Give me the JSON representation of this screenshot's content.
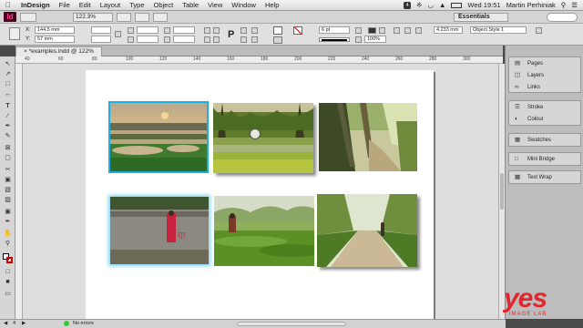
{
  "menubar": {
    "app": "InDesign",
    "items": [
      "File",
      "Edit",
      "Layout",
      "Type",
      "Object",
      "Table",
      "View",
      "Window",
      "Help"
    ],
    "badge": "4",
    "clock": "Wed 19:51",
    "user": "Martin Perhiniak"
  },
  "appbar": {
    "logo": "Id",
    "zoom": "122.3%",
    "workspace": "Essentials"
  },
  "control": {
    "x": "144.5 mm",
    "y": "57 mm",
    "stroke_weight": "6 pt",
    "opacity": "100%",
    "fit_value": "4.233 mm",
    "object_style": "Object Style 1"
  },
  "document": {
    "tab": "*examples.indd @ 122%",
    "ruler_ticks": [
      "40",
      "60",
      "80",
      "100",
      "120",
      "140",
      "160",
      "180",
      "200",
      "220",
      "240",
      "260",
      "280",
      "300"
    ]
  },
  "status": {
    "page": "4",
    "errors": "No errors"
  },
  "panels": {
    "group1": [
      "Pages",
      "Layers",
      "Links"
    ],
    "group2": [
      "Stroke",
      "Colour"
    ],
    "group3": [
      "Swatches"
    ],
    "group4": [
      "Mini Bridge"
    ],
    "group5": [
      "Text Wrap"
    ]
  },
  "watermark": {
    "brand": "yes",
    "sub": "IMAGE LAB"
  },
  "colors": {
    "selection": "#1ab0e6",
    "indesign_brand": "#ff3f94",
    "watermark": "#e3262d"
  }
}
